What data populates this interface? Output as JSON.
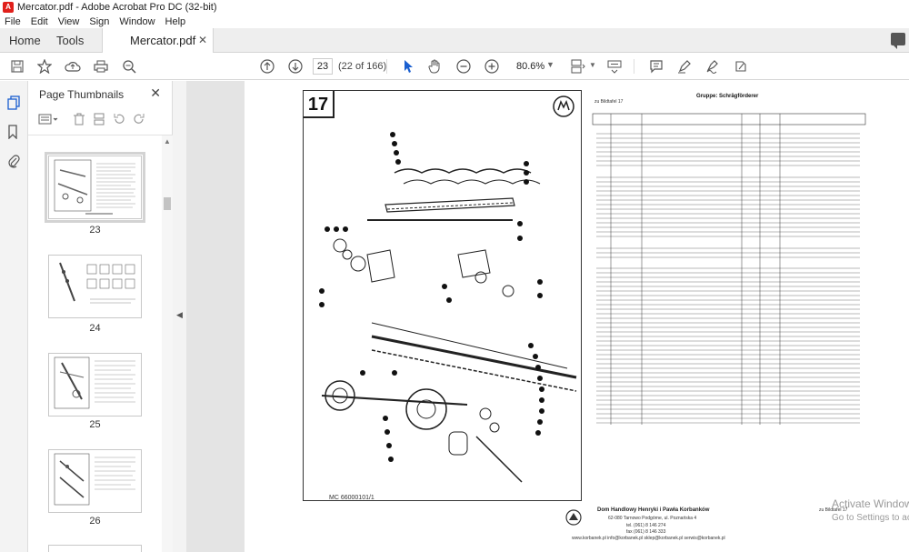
{
  "window": {
    "title": "Mercator.pdf - Adobe Acrobat Pro DC (32-bit)"
  },
  "menu": [
    "File",
    "Edit",
    "View",
    "Sign",
    "Window",
    "Help"
  ],
  "tabs": {
    "home": "Home",
    "tools": "Tools",
    "document": "Mercator.pdf"
  },
  "toolbar": {
    "page_current": "23",
    "page_count": "(22 of 166)",
    "zoom": "80.6%"
  },
  "icons": {
    "save": "save-icon",
    "bookmark": "star-icon",
    "upload": "cloud-upload-icon",
    "print": "print-icon",
    "search": "zoom-search-icon",
    "prev": "arrow-up-circle-icon",
    "next": "arrow-down-circle-icon",
    "select": "cursor-icon",
    "hand": "hand-icon",
    "zoom_out": "minus-circle-icon",
    "zoom_in": "plus-circle-icon",
    "fit": "fit-page-icon",
    "scroll": "scroll-mode-icon",
    "comment": "comment-icon",
    "highlight": "highlight-pen-icon",
    "sign": "sign-icon",
    "fill": "fill-sign-icon"
  },
  "panel": {
    "title": "Page Thumbnails",
    "thumbnails": [
      {
        "label": "23"
      },
      {
        "label": "24"
      },
      {
        "label": "25"
      },
      {
        "label": "26"
      }
    ]
  },
  "document": {
    "plate_number": "17",
    "mc_label": "MC 66000101/1",
    "zu_label_top": "zu Bildtafel 17",
    "zu_label_bottom": "zu Bildtafel 17",
    "group_header": "Gruppe: Schrägförderer",
    "publisher": {
      "name": "Dom Handlowy Henryki i Pawła Korbanków",
      "address": "62-080 Tarnowo Podgórne, ul. Poznańska 4",
      "tel": "tel. (061) 8 146 274",
      "fax": "fax (061) 8 146 333",
      "web": "www.korbanek.pl  info@korbanek.pl  sklep@korbanek.pl  serwis@korbanek.pl"
    }
  },
  "overlay": {
    "activate_line1": "Activate Windows",
    "activate_line2": "Go to Settings to activate Windows."
  }
}
